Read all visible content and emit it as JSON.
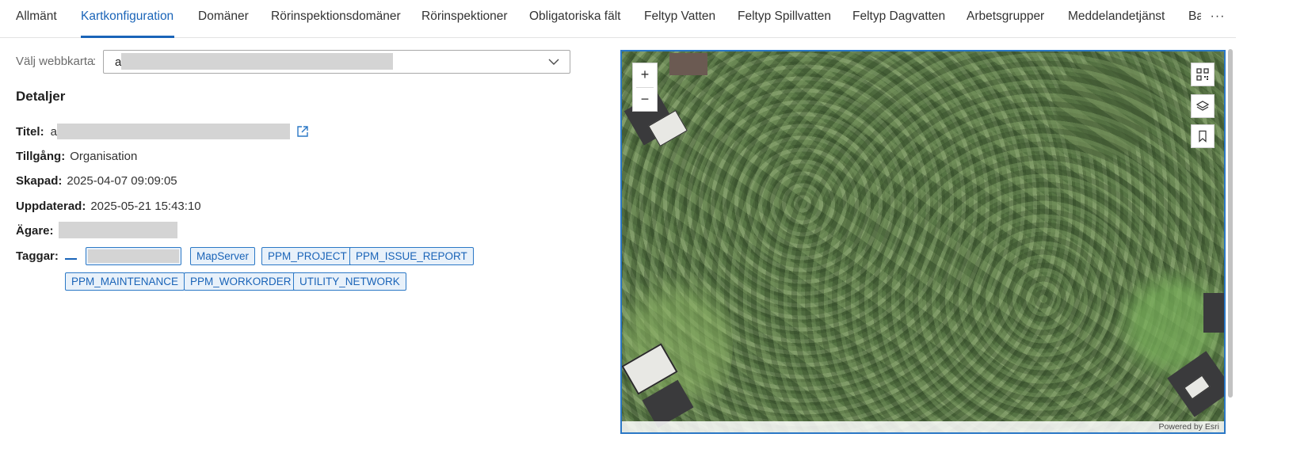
{
  "tabs": [
    {
      "label": "Allmänt",
      "active": false
    },
    {
      "label": "Kartkonfiguration",
      "active": true
    },
    {
      "label": "Domäner",
      "active": false
    },
    {
      "label": "Rörinspektionsdomäner",
      "active": false
    },
    {
      "label": "Rörinspektioner",
      "active": false
    },
    {
      "label": "Obligatoriska fält",
      "active": false
    },
    {
      "label": "Feltyp Vatten",
      "active": false
    },
    {
      "label": "Feltyp Spillvatten",
      "active": false
    },
    {
      "label": "Feltyp Dagvatten",
      "active": false
    },
    {
      "label": "Arbetsgrupper",
      "active": false
    },
    {
      "label": "Meddelandetjänst",
      "active": false
    },
    {
      "label": "Ba",
      "active": false
    }
  ],
  "more_label": "···",
  "webmap": {
    "label": "Välj webbkarta",
    "value": "a"
  },
  "details": {
    "heading": "Detaljer",
    "title_label": "Titel:",
    "title_value": "a",
    "access_label": "Tillgång:",
    "access_value": "Organisation",
    "created_label": "Skapad:",
    "created_value": "2025-04-07 09:09:05",
    "updated_label": "Uppdaterad:",
    "updated_value": "2025-05-21 15:43:10",
    "owner_label": "Ägare:",
    "tags_label": "Taggar:",
    "tags": [
      "MapServer",
      "PPM_PROJECT",
      "PPM_ISSUE_REPORT",
      "PPM_MAINTENANCE",
      "PPM_WORKORDER",
      "UTILITY_NETWORK"
    ]
  },
  "map": {
    "zoom_in": "+",
    "zoom_out": "−",
    "attribution": "Powered by Esri",
    "tools": [
      "qr-grid-icon",
      "layers-icon",
      "bookmark-icon"
    ]
  },
  "colors": {
    "accent": "#1a64b8",
    "tag_border": "#2b78c6",
    "tag_bg": "#e8f1fa"
  }
}
